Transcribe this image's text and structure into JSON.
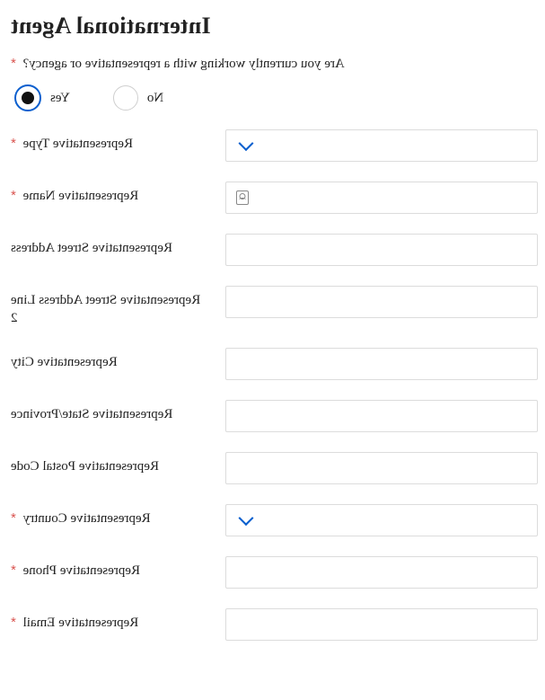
{
  "title": "International Agent",
  "question": "Are you currently working with a representative or agency?",
  "options": {
    "yes": "Yes",
    "no": "No"
  },
  "selected": "yes",
  "fields": {
    "type": {
      "label": "Representative Type",
      "required": true,
      "kind": "select",
      "value": ""
    },
    "name": {
      "label": "Representative Name",
      "required": true,
      "kind": "text-contact",
      "value": ""
    },
    "addr1": {
      "label": "Representative Street Address",
      "required": false,
      "kind": "text",
      "value": ""
    },
    "addr2": {
      "label": "Representative Street Address Line 2",
      "required": false,
      "kind": "text",
      "value": ""
    },
    "city": {
      "label": "Representative City",
      "required": false,
      "kind": "text",
      "value": ""
    },
    "state": {
      "label": "Representative State/Province",
      "required": false,
      "kind": "text",
      "value": ""
    },
    "postal": {
      "label": "Representative Postal Code",
      "required": false,
      "kind": "text",
      "value": ""
    },
    "country": {
      "label": "Representative Country",
      "required": true,
      "kind": "select",
      "value": ""
    },
    "phone": {
      "label": "Representative Phone",
      "required": true,
      "kind": "text",
      "value": ""
    },
    "email": {
      "label": "Representative Email",
      "required": true,
      "kind": "text",
      "value": ""
    }
  },
  "required_marker": "*"
}
